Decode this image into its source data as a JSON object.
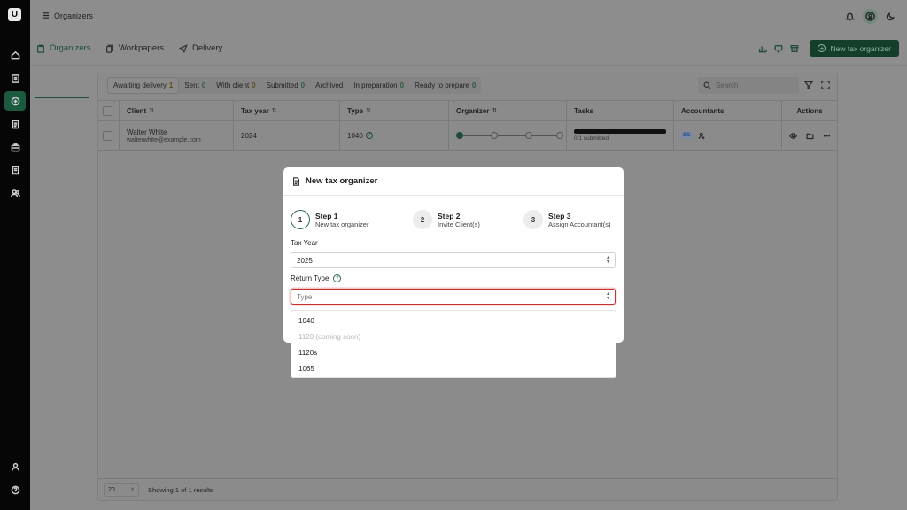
{
  "app": {
    "title": "Organizers",
    "logo_letter": "U"
  },
  "sidebar": {
    "items": [
      "home",
      "clients",
      "organizers",
      "documents",
      "briefcase",
      "invoices",
      "team",
      "profile",
      "help"
    ],
    "active": "organizers"
  },
  "tabs": [
    {
      "label": "Organizers",
      "active": true
    },
    {
      "label": "Workpapers",
      "active": false
    },
    {
      "label": "Delivery",
      "active": false
    }
  ],
  "toolbar": {
    "new_button": "New tax organizer"
  },
  "filters": [
    {
      "label": "Awaiting delivery",
      "count": "1"
    },
    {
      "label": "Sent",
      "count": "0"
    },
    {
      "label": "With client",
      "count": "0"
    },
    {
      "label": "Submitted",
      "count": "0"
    },
    {
      "label": "Archived",
      "count": ""
    },
    {
      "label": "In preparation",
      "count": "0"
    },
    {
      "label": "Ready to prepare",
      "count": "0"
    }
  ],
  "search": {
    "placeholder": "Search"
  },
  "table": {
    "columns": [
      "Client",
      "Tax year",
      "Type",
      "Organizer",
      "Tasks",
      "Accountants",
      "Actions"
    ],
    "rows": [
      {
        "client_name": "Walter White",
        "client_email": "walterwhite@example.com",
        "tax_year": "2024",
        "type": "1040",
        "tasks": "0/1 submitted",
        "accountant": "SG"
      }
    ]
  },
  "footer": {
    "page_size": "20",
    "showing": "Showing 1 of 1 results"
  },
  "modal": {
    "title": "New tax organizer",
    "steps": [
      {
        "num": "1",
        "title": "Step 1",
        "sub": "New tax organizer"
      },
      {
        "num": "2",
        "title": "Step 2",
        "sub": "Invite Client(s)"
      },
      {
        "num": "3",
        "title": "Step 3",
        "sub": "Assign Accountant(s)"
      }
    ],
    "tax_year_label": "Tax Year",
    "tax_year_value": "2025",
    "return_type_label": "Return Type",
    "return_type_placeholder": "Type",
    "options": [
      {
        "label": "1040",
        "disabled": false
      },
      {
        "label": "1120 (coming soon)",
        "disabled": true
      },
      {
        "label": "1120s",
        "disabled": false
      },
      {
        "label": "1065",
        "disabled": false
      }
    ]
  },
  "colors": {
    "brand_green": "#1f4d37",
    "focus_red": "#c9312c",
    "overlay": "#8d8d8d"
  }
}
